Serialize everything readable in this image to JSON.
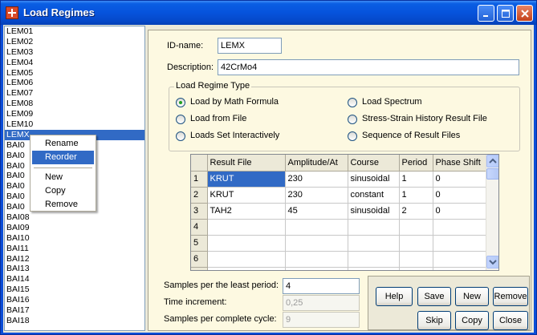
{
  "window": {
    "title": "Load Regimes"
  },
  "list": {
    "items": [
      "LEM01",
      "LEM02",
      "LEM03",
      "LEM04",
      "LEM05",
      "LEM06",
      "LEM07",
      "LEM08",
      "LEM09",
      "LEM10",
      "LEMX",
      "BAI01",
      "BAI02",
      "BAI03",
      "BAI04",
      "BAI05",
      "BAI06",
      "BAI07",
      "BAI08",
      "BAI09",
      "BAI10",
      "BAI11",
      "BAI12",
      "BAI13",
      "BAI14",
      "BAI15",
      "BAI16",
      "BAI17",
      "BAI18"
    ],
    "visible_items": [
      "LEM01",
      "LEM02",
      "LEM03",
      "LEM04",
      "LEM05",
      "LEM06",
      "LEM07",
      "LEM08",
      "LEM09",
      "LEM10",
      "LEMX",
      "BAI0",
      "BAI0",
      "BAI0",
      "BAI0",
      "BAI0",
      "BAI0",
      "BAI0",
      "BAI08",
      "BAI09",
      "BAI10",
      "BAI11",
      "BAI12",
      "BAI13",
      "BAI14",
      "BAI15",
      "BAI16",
      "BAI17",
      "BAI18"
    ],
    "selected": "LEMX"
  },
  "context_menu": {
    "items": [
      "Rename",
      "Reorder",
      "New",
      "Copy",
      "Remove"
    ],
    "hovered": "Reorder"
  },
  "form": {
    "id_label": "ID-name:",
    "id_value": "LEMX",
    "desc_label": "Description:",
    "desc_value": "42CrMo4",
    "group_title": "Load Regime Type",
    "options": {
      "math": "Load by Math Formula",
      "file": "Load from File",
      "interactive": "Loads Set Interactively",
      "spectrum": "Load Spectrum",
      "stress": "Stress-Strain History Result File",
      "sequence": "Sequence of Result Files"
    },
    "selected_option": "Load by Math Formula"
  },
  "grid": {
    "columns": [
      "Result File",
      "Amplitude/At",
      "Course",
      "Period",
      "Phase Shift"
    ],
    "rows": [
      [
        "1",
        "KRUT",
        "230",
        "sinusoidal",
        "1",
        "0"
      ],
      [
        "2",
        "KRUT",
        "230",
        "constant",
        "1",
        "0"
      ],
      [
        "3",
        "TAH2",
        "45",
        "sinusoidal",
        "2",
        "0"
      ],
      [
        "4",
        "",
        "",
        "",
        "",
        ""
      ],
      [
        "5",
        "",
        "",
        "",
        "",
        ""
      ],
      [
        "6",
        "",
        "",
        "",
        "",
        ""
      ],
      [
        "7",
        "",
        "",
        "",
        "",
        ""
      ]
    ]
  },
  "params": {
    "samples_label": "Samples per the least period:",
    "samples_value": "4",
    "time_label": "Time increment:",
    "time_value": "0,25",
    "cycle_label": "Samples per complete cycle:",
    "cycle_value": "9"
  },
  "buttons": {
    "help": "Help",
    "save": "Save",
    "new": "New",
    "remove": "Remove",
    "skip": "Skip",
    "copy": "Copy",
    "close": "Close"
  },
  "colors": {
    "accent": "#316ac5",
    "title_bar": "#0653dc",
    "panel": "#fdf9e1"
  },
  "icons": {
    "app": "app-icon",
    "minimize": "minimize-icon",
    "maximize": "maximize-icon",
    "close": "close-icon"
  }
}
